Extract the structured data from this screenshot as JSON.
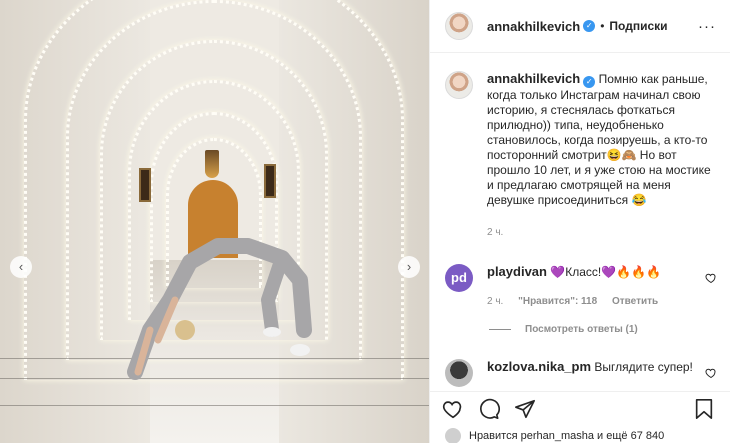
{
  "post": {
    "author": "annakhilkevich",
    "follow_label": "Подписки",
    "separator": "•",
    "more_icon": "more-options-icon",
    "caption": "Помню как раньше, когда только Инстаграм начинал свою историю, я стеснялась фоткаться прилюдно)) типа, неудобненько становилось, когда позируешь, а кто-то посторонний смотрит😆🙈 Но вот прошло 10 лет, и я уже стою на мостике и предлагаю смотрящей на меня девушке присоединиться 😂",
    "caption_time": "2 ч."
  },
  "comments": [
    {
      "author": "playdivan",
      "avatar_text": "pd",
      "text": "💜Класс!💜🔥🔥🔥",
      "time": "2 ч.",
      "likes": "\"Нравится\": 118",
      "reply_label": "Ответить",
      "view_replies": "Посмотреть ответы (1)"
    },
    {
      "author": "kozlova.nika_pm",
      "text": "Выглядите супер!"
    }
  ],
  "footer": {
    "liked_by": "Нравится perhan_masha и ещё 67 840"
  },
  "colors": {
    "verified": "#3897f0",
    "text": "#262626",
    "muted": "#8e8e8e",
    "purple_heart": "#7b5bc4"
  }
}
